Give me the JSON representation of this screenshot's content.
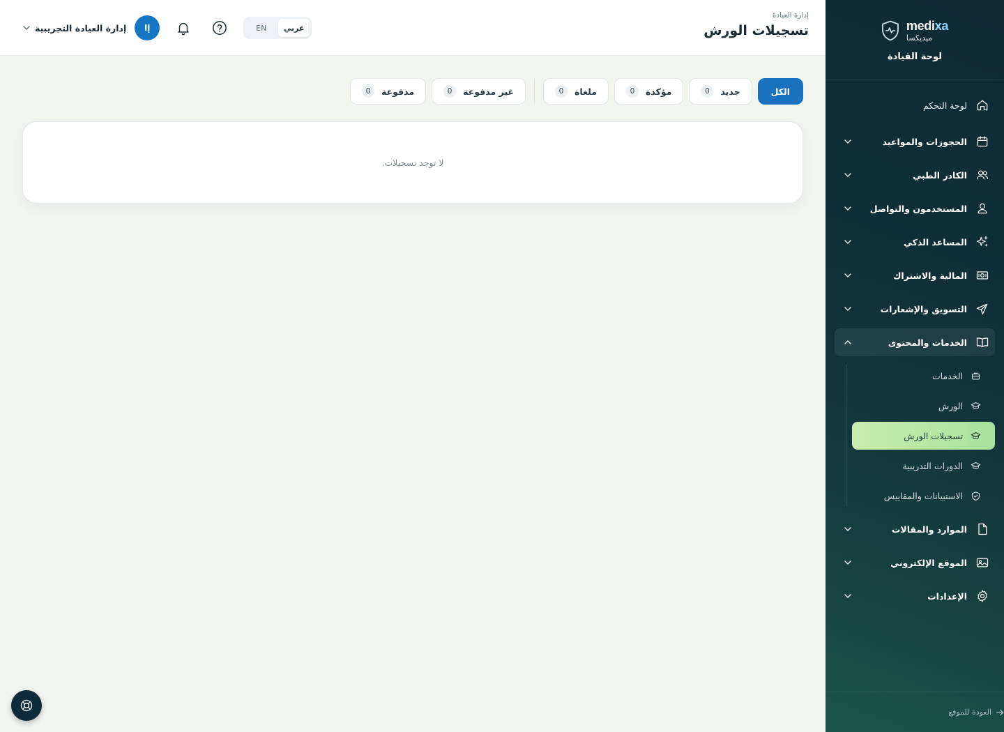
{
  "brand": {
    "name_en_base": "medi",
    "name_en_accent": "xa",
    "name_ar": "ميديكسا",
    "subtitle": "لوحة القيادة"
  },
  "header": {
    "breadcrumb": "إدارة العيادة",
    "title": "تسجيلات الورش",
    "user": {
      "initials": "إا",
      "name": "إدارة العيادة التجريبية"
    },
    "lang": {
      "ar": "عربي",
      "en": "EN",
      "selected": "ar"
    }
  },
  "filters": [
    {
      "label": "الكل",
      "count": "",
      "active": true
    },
    {
      "label": "جديد",
      "count": "0"
    },
    {
      "label": "مؤكدة",
      "count": "0"
    },
    {
      "label": "ملغاة",
      "count": "0"
    },
    {
      "label": "غير مدفوعة",
      "count": "0"
    },
    {
      "label": "مدفوعة",
      "count": "0"
    }
  ],
  "empty_text": "لا توجد تسجيلات.",
  "sidebar": {
    "items": [
      {
        "label": "لوحة التحكم",
        "icon": "home-icon"
      },
      {
        "label": "الحجوزات والمواعيد",
        "icon": "calendar-icon"
      },
      {
        "label": "الكادر الطبي",
        "icon": "users-icon"
      },
      {
        "label": "المستخدمون والتواصل",
        "icon": "user-icon"
      },
      {
        "label": "المساعد الذكي",
        "icon": "sparkles-icon"
      },
      {
        "label": "المالية والاشتراك",
        "icon": "money-icon"
      },
      {
        "label": "التسويق والإشعارات",
        "icon": "send-icon"
      },
      {
        "label": "الخدمات والمحتوى",
        "icon": "book-icon"
      },
      {
        "label": "الموارد والمقالات",
        "icon": "file-icon"
      },
      {
        "label": "الموقع الإلكتروني",
        "icon": "image-icon"
      },
      {
        "label": "الإعدادات",
        "icon": "gear-icon"
      }
    ],
    "sub_items": [
      {
        "label": "الخدمات",
        "icon": "briefcase-icon"
      },
      {
        "label": "الورش",
        "icon": "graduation-cap-icon"
      },
      {
        "label": "تسجيلات الورش",
        "icon": "graduation-cap-icon",
        "active": true
      },
      {
        "label": "الدورات التدريبية",
        "icon": "graduation-cap-icon"
      },
      {
        "label": "الاستبيانات والمقاييس",
        "icon": "shield-check-icon"
      }
    ],
    "back_link": "العودة للموقع"
  },
  "colors": {
    "primary": "#1a72bf",
    "active_sub": "#c8ecb0",
    "sidebar_bg": "#0f2a35"
  }
}
